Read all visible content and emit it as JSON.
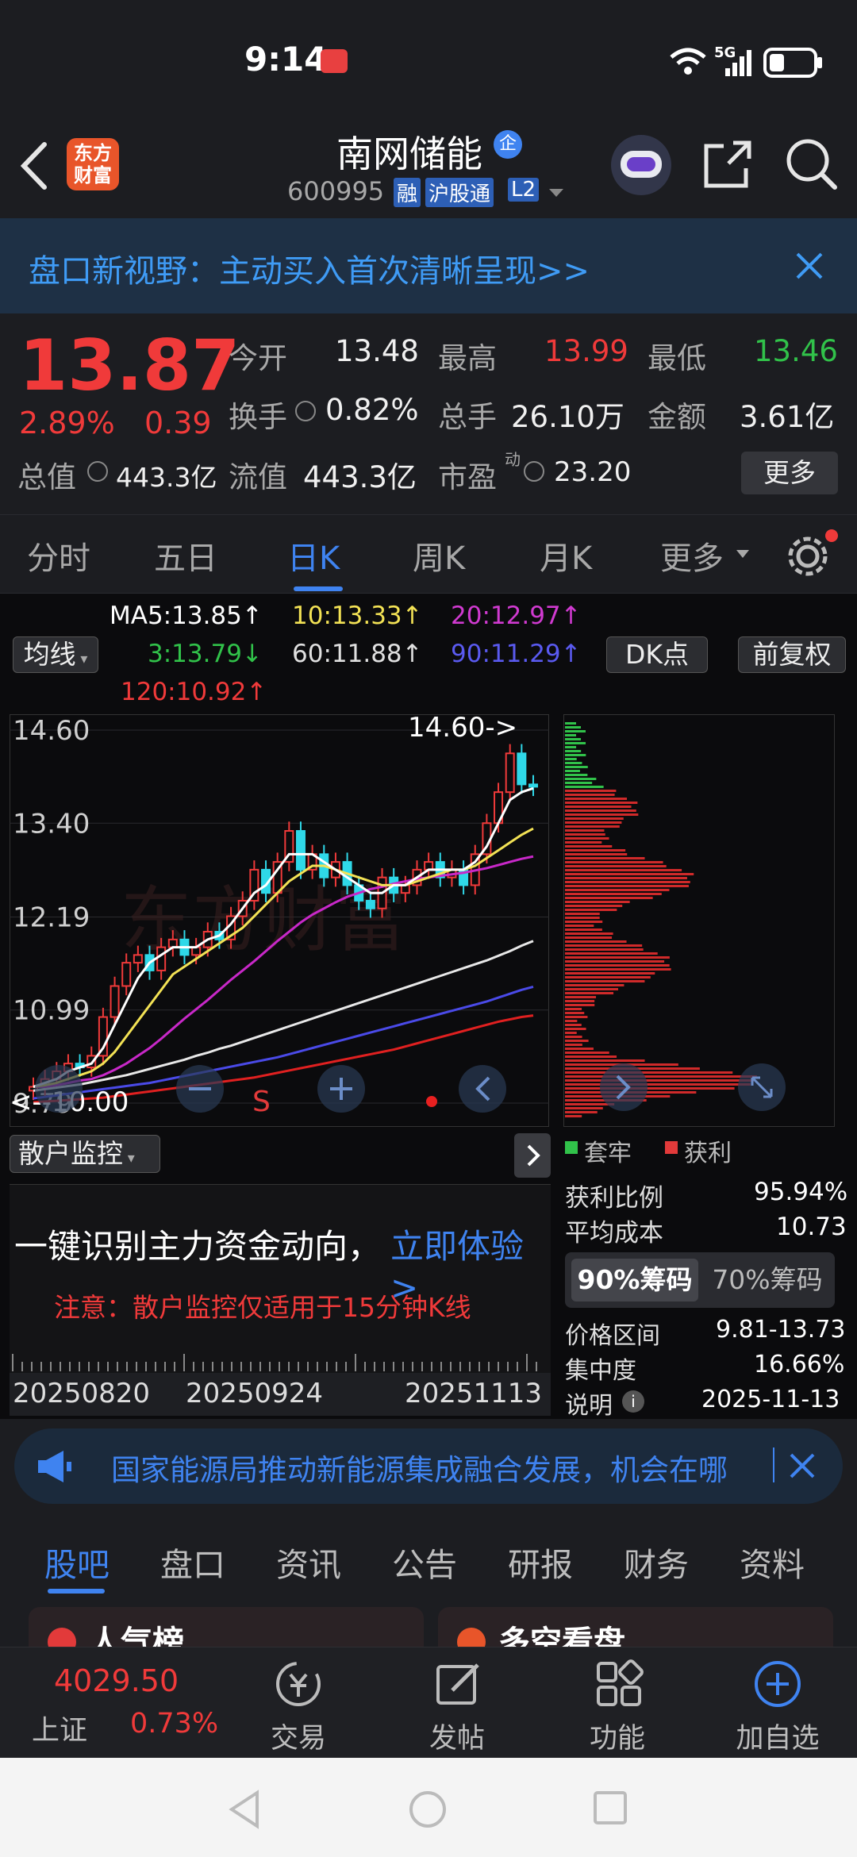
{
  "status": {
    "time": "9:14",
    "network": "5G"
  },
  "header": {
    "app_logo_line1": "东方",
    "app_logo_line2": "财富",
    "stock_name": "南网储能",
    "enterprise_badge": "企",
    "stock_code": "600995",
    "tag_margin": "融",
    "tag_connect": "沪股通",
    "tag_level": "L2"
  },
  "banner": {
    "text": "盘口新视野：主动买入首次清晰呈现>>"
  },
  "quote": {
    "price": "13.87",
    "change_pct": "2.89%",
    "change_amt": "0.39",
    "open_label": "今开",
    "open": "13.48",
    "high_label": "最高",
    "high": "13.99",
    "low_label": "最低",
    "low": "13.46",
    "turnover_label": "换手",
    "turnover": "0.82%",
    "volume_label": "总手",
    "volume": "26.10万",
    "amount_label": "金额",
    "amount": "3.61亿",
    "mktcap_label": "总值",
    "mktcap": "443.3亿",
    "float_label": "流值",
    "float": "443.3亿",
    "pe_label": "市盈",
    "pe_sup": "动",
    "pe": "23.20",
    "more_button": "更多"
  },
  "ktabs": [
    "分时",
    "五日",
    "日K",
    "周K",
    "月K",
    "更多"
  ],
  "indicators": {
    "ma_selector": "均线",
    "ma5": "MA5:13.85↑",
    "ma10": "10:13.33↑",
    "ma20": "20:12.97↑",
    "ma3": "3:13.79↓",
    "ma60": "60:11.88↑",
    "ma90": "90:11.29↑",
    "ma120": "120:10.92↑",
    "dk_button": "DK点",
    "adjust_button": "前复权"
  },
  "chart_data": {
    "type": "candlestick",
    "y_ticks": [
      "14.60",
      "13.40",
      "12.19",
      "10.99",
      "9.79"
    ],
    "x_ticks": [
      "20250820",
      "20250924",
      "20251113"
    ],
    "max_label": "14.60->",
    "min_label": "<--10.00",
    "ylim": [
      9.79,
      14.6
    ],
    "watermark": "东方财富",
    "candles_close": [
      10.0,
      10.1,
      10.2,
      10.3,
      10.25,
      10.4,
      10.9,
      11.3,
      11.6,
      11.7,
      11.5,
      11.8,
      11.9,
      11.7,
      11.8,
      12.0,
      11.9,
      12.2,
      12.4,
      12.8,
      12.5,
      12.9,
      13.3,
      12.8,
      13.0,
      12.7,
      12.9,
      12.6,
      12.4,
      12.3,
      12.7,
      12.5,
      12.6,
      12.8,
      12.9,
      12.7,
      12.8,
      12.6,
      13.0,
      13.4,
      13.8,
      14.3,
      13.9,
      13.87
    ],
    "ma5": [
      10.0,
      10.05,
      10.1,
      10.2,
      10.25,
      10.3,
      10.5,
      10.8,
      11.1,
      11.4,
      11.6,
      11.7,
      11.8,
      11.8,
      11.8,
      11.9,
      11.95,
      12.1,
      12.3,
      12.5,
      12.6,
      12.8,
      13.0,
      13.0,
      13.0,
      12.9,
      12.8,
      12.7,
      12.6,
      12.5,
      12.5,
      12.6,
      12.6,
      12.7,
      12.8,
      12.8,
      12.8,
      12.8,
      12.9,
      13.1,
      13.4,
      13.7,
      13.8,
      13.85
    ],
    "ma10": [
      10.0,
      10.02,
      10.05,
      10.1,
      10.15,
      10.2,
      10.3,
      10.45,
      10.65,
      10.85,
      11.05,
      11.25,
      11.45,
      11.55,
      11.65,
      11.75,
      11.85,
      11.95,
      12.05,
      12.2,
      12.35,
      12.5,
      12.65,
      12.75,
      12.85,
      12.85,
      12.8,
      12.75,
      12.7,
      12.65,
      12.6,
      12.6,
      12.6,
      12.65,
      12.7,
      12.75,
      12.8,
      12.8,
      12.85,
      12.95,
      13.05,
      13.15,
      13.25,
      13.33
    ],
    "ma20": [
      10.0,
      10.0,
      10.02,
      10.05,
      10.08,
      10.1,
      10.15,
      10.22,
      10.3,
      10.4,
      10.5,
      10.62,
      10.75,
      10.88,
      11.0,
      11.12,
      11.25,
      11.38,
      11.5,
      11.62,
      11.75,
      11.88,
      12.0,
      12.12,
      12.22,
      12.3,
      12.38,
      12.45,
      12.5,
      12.55,
      12.58,
      12.62,
      12.65,
      12.68,
      12.7,
      12.72,
      12.74,
      12.76,
      12.79,
      12.82,
      12.86,
      12.9,
      12.94,
      12.97
    ],
    "ma60": [
      9.95,
      9.97,
      9.99,
      10.01,
      10.03,
      10.06,
      10.09,
      10.12,
      10.15,
      10.19,
      10.23,
      10.27,
      10.31,
      10.35,
      10.4,
      10.44,
      10.49,
      10.53,
      10.58,
      10.63,
      10.68,
      10.73,
      10.78,
      10.83,
      10.88,
      10.93,
      10.98,
      11.03,
      11.08,
      11.13,
      11.18,
      11.23,
      11.28,
      11.33,
      11.38,
      11.43,
      11.48,
      11.53,
      11.58,
      11.63,
      11.69,
      11.75,
      11.82,
      11.88
    ],
    "ma90": [
      9.85,
      9.87,
      9.89,
      9.91,
      9.93,
      9.95,
      9.97,
      9.99,
      10.01,
      10.03,
      10.05,
      10.08,
      10.11,
      10.14,
      10.17,
      10.2,
      10.23,
      10.26,
      10.29,
      10.32,
      10.35,
      10.38,
      10.42,
      10.46,
      10.5,
      10.54,
      10.58,
      10.62,
      10.66,
      10.7,
      10.74,
      10.78,
      10.82,
      10.86,
      10.9,
      10.94,
      10.98,
      11.02,
      11.06,
      11.1,
      11.15,
      11.2,
      11.25,
      11.29
    ],
    "ma120": [
      9.8,
      9.81,
      9.82,
      9.83,
      9.84,
      9.85,
      9.86,
      9.88,
      9.9,
      9.92,
      9.94,
      9.96,
      9.98,
      10.0,
      10.02,
      10.04,
      10.06,
      10.08,
      10.1,
      10.12,
      10.15,
      10.18,
      10.21,
      10.24,
      10.27,
      10.3,
      10.33,
      10.36,
      10.39,
      10.42,
      10.45,
      10.48,
      10.52,
      10.56,
      10.6,
      10.64,
      10.68,
      10.72,
      10.76,
      10.8,
      10.84,
      10.87,
      10.9,
      10.92
    ]
  },
  "chip_panel": {
    "legend_loss": "套牢",
    "legend_profit": "获利",
    "profit_ratio_label": "获利比例",
    "profit_ratio": "95.94%",
    "avg_cost_label": "平均成本",
    "avg_cost": "10.73",
    "tab_90": "90%筹码",
    "tab_70": "70%筹码",
    "range_label": "价格区间",
    "range": "9.81-13.73",
    "concentration_label": "集中度",
    "concentration": "16.66%",
    "note_label": "说明",
    "note_date": "2025-11-13"
  },
  "retail": {
    "selector": "散户监控",
    "headline": "一键识别主力资金动向，",
    "cta": "立即体验>",
    "notice": "注意：散户监控仅适用于15分钟K线"
  },
  "news": {
    "text": "国家能源局推动新能源集成融合发展，机会在哪"
  },
  "btabs": [
    "股吧",
    "盘口",
    "资讯",
    "公告",
    "研报",
    "财务",
    "资料"
  ],
  "peek": {
    "left": "人气榜",
    "right": "多空看盘"
  },
  "bnav": {
    "index_value": "4029.50",
    "index_name": "上证",
    "index_change": "0.73%",
    "trade": "交易",
    "post": "发帖",
    "functions": "功能",
    "add_watch": "加自选"
  },
  "colors": {
    "up": "#f03a3a",
    "down": "#31c24a",
    "accent": "#3f83f0",
    "bg": "#1c1d21"
  }
}
